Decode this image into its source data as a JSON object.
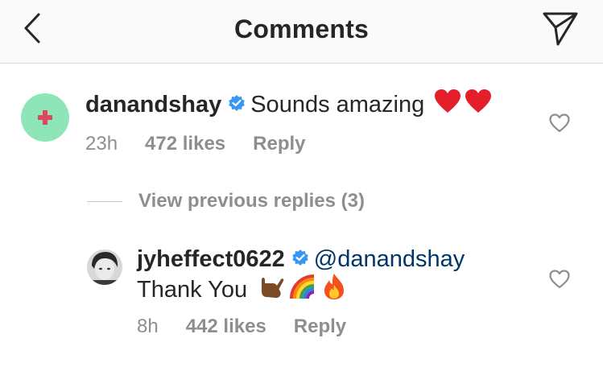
{
  "header": {
    "title": "Comments",
    "back_icon": "chevron-left-icon",
    "send_icon": "paper-plane-icon"
  },
  "comment": {
    "username": "danandshay",
    "text": "Sounds amazing",
    "emoji": [
      "red-heart",
      "red-heart"
    ],
    "time": "23h",
    "likes": "472 likes",
    "reply_label": "Reply"
  },
  "view_previous": {
    "label": "View previous replies (3)"
  },
  "reply": {
    "username": "jyheffect0622",
    "mention": "@danandshay",
    "text": "Thank You",
    "emoji": [
      "call-me-hand",
      "rainbow",
      "fire"
    ],
    "time": "8h",
    "likes": "442 likes",
    "reply_label": "Reply"
  },
  "colors": {
    "verified": "#3897f0",
    "mention": "#003569",
    "muted": "#8e8e8e",
    "avatar_bg": "#8ee6b8"
  }
}
